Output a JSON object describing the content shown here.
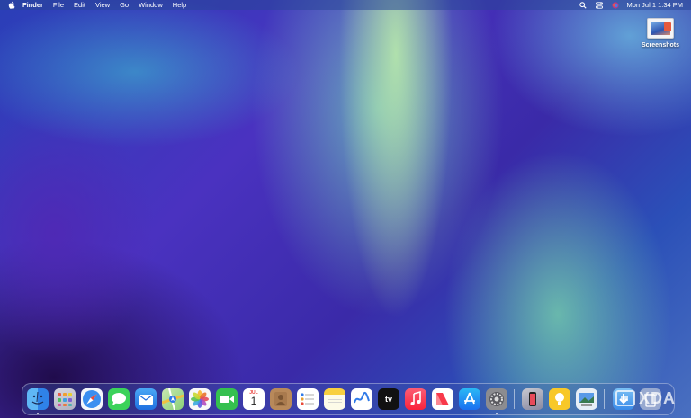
{
  "menubar": {
    "app_name": "Finder",
    "menus": [
      "File",
      "Edit",
      "View",
      "Go",
      "Window",
      "Help"
    ],
    "status_icons": [
      "search-icon",
      "control-center-icon",
      "siri-icon"
    ],
    "clock": "Mon Jul 1  1:34 PM"
  },
  "desktop": {
    "items": [
      {
        "label": "Screenshots",
        "icon": "screenshots-folder-icon"
      }
    ]
  },
  "dock": {
    "apps": [
      {
        "name": "Finder",
        "icon": "finder-icon",
        "running": true
      },
      {
        "name": "Launchpad",
        "icon": "launchpad-icon",
        "running": false
      },
      {
        "name": "Safari",
        "icon": "safari-icon",
        "running": false
      },
      {
        "name": "Messages",
        "icon": "messages-icon",
        "running": false
      },
      {
        "name": "Mail",
        "icon": "mail-icon",
        "running": false
      },
      {
        "name": "Maps",
        "icon": "maps-icon",
        "running": false
      },
      {
        "name": "Photos",
        "icon": "photos-icon",
        "running": false
      },
      {
        "name": "FaceTime",
        "icon": "facetime-icon",
        "running": false
      },
      {
        "name": "Calendar",
        "icon": "calendar-icon",
        "running": false,
        "month": "JUL",
        "day": "1"
      },
      {
        "name": "Contacts",
        "icon": "contacts-icon",
        "running": false
      },
      {
        "name": "Reminders",
        "icon": "reminders-icon",
        "running": false
      },
      {
        "name": "Notes",
        "icon": "notes-icon",
        "running": false
      },
      {
        "name": "Freeform",
        "icon": "freeform-icon",
        "running": false
      },
      {
        "name": "TV",
        "icon": "apple-tv-icon",
        "running": false,
        "label": "tv"
      },
      {
        "name": "Music",
        "icon": "music-icon",
        "running": false
      },
      {
        "name": "News",
        "icon": "news-icon",
        "running": false
      },
      {
        "name": "App Store",
        "icon": "app-store-icon",
        "running": false
      },
      {
        "name": "System Settings",
        "icon": "system-settings-icon",
        "running": true
      },
      {
        "name": "iPhone Mirroring",
        "icon": "iphone-mirroring-icon",
        "running": false
      },
      {
        "name": "Tips",
        "icon": "tips-icon",
        "running": false
      },
      {
        "name": "Preview",
        "icon": "preview-icon",
        "running": false
      },
      {
        "name": "Downloads",
        "icon": "downloads-stack-icon",
        "running": false
      },
      {
        "name": "Trash",
        "icon": "trash-icon",
        "running": false
      }
    ]
  },
  "watermark": {
    "text": "XDA"
  }
}
